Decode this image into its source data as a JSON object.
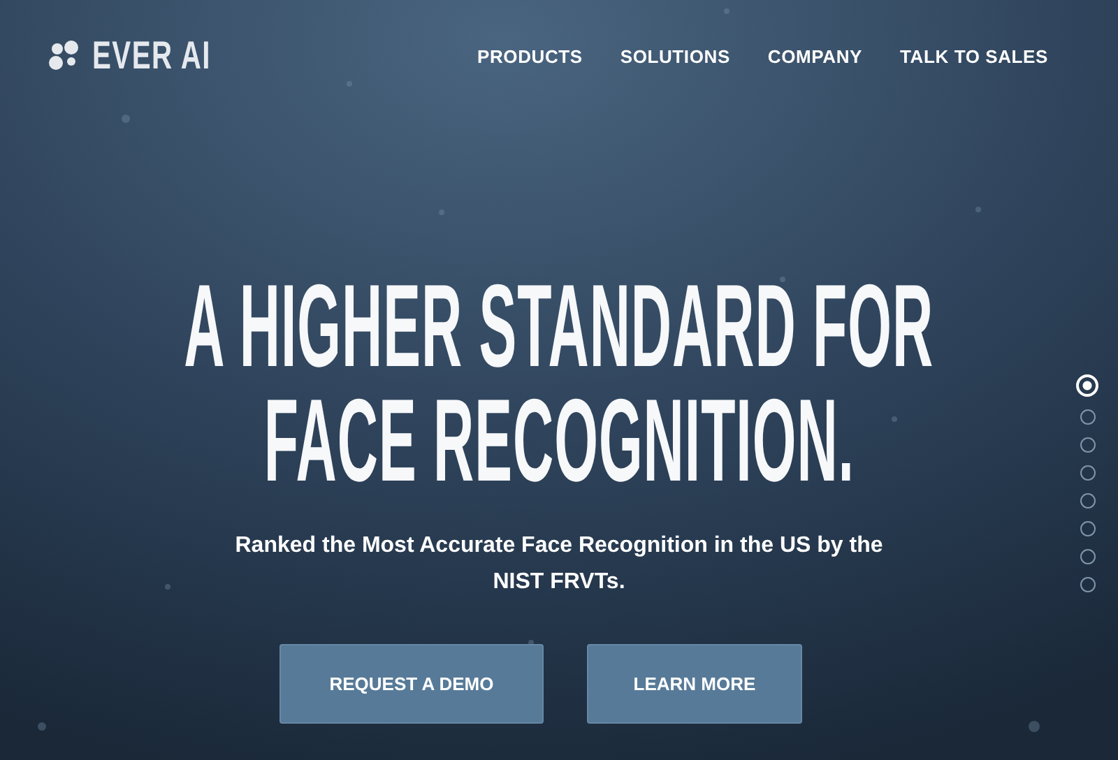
{
  "header": {
    "logo_text": "EVER AI",
    "nav": [
      {
        "label": "PRODUCTS"
      },
      {
        "label": "SOLUTIONS"
      },
      {
        "label": "COMPANY"
      },
      {
        "label": "TALK TO SALES"
      }
    ]
  },
  "hero": {
    "headline_lines": [
      "A HIGHER STANDARD FOR",
      "FACE RECOGNITION."
    ],
    "subtitle": "Ranked the Most Accurate Face Recognition in the US by the NIST FRVTs.",
    "buttons": [
      {
        "label": "REQUEST A DEMO"
      },
      {
        "label": "LEARN MORE"
      }
    ]
  },
  "slide_dots": [
    {
      "selected": true
    },
    {
      "selected": false
    },
    {
      "selected": false
    },
    {
      "selected": false
    },
    {
      "selected": false
    },
    {
      "selected": false
    },
    {
      "selected": false
    },
    {
      "selected": false
    }
  ]
}
